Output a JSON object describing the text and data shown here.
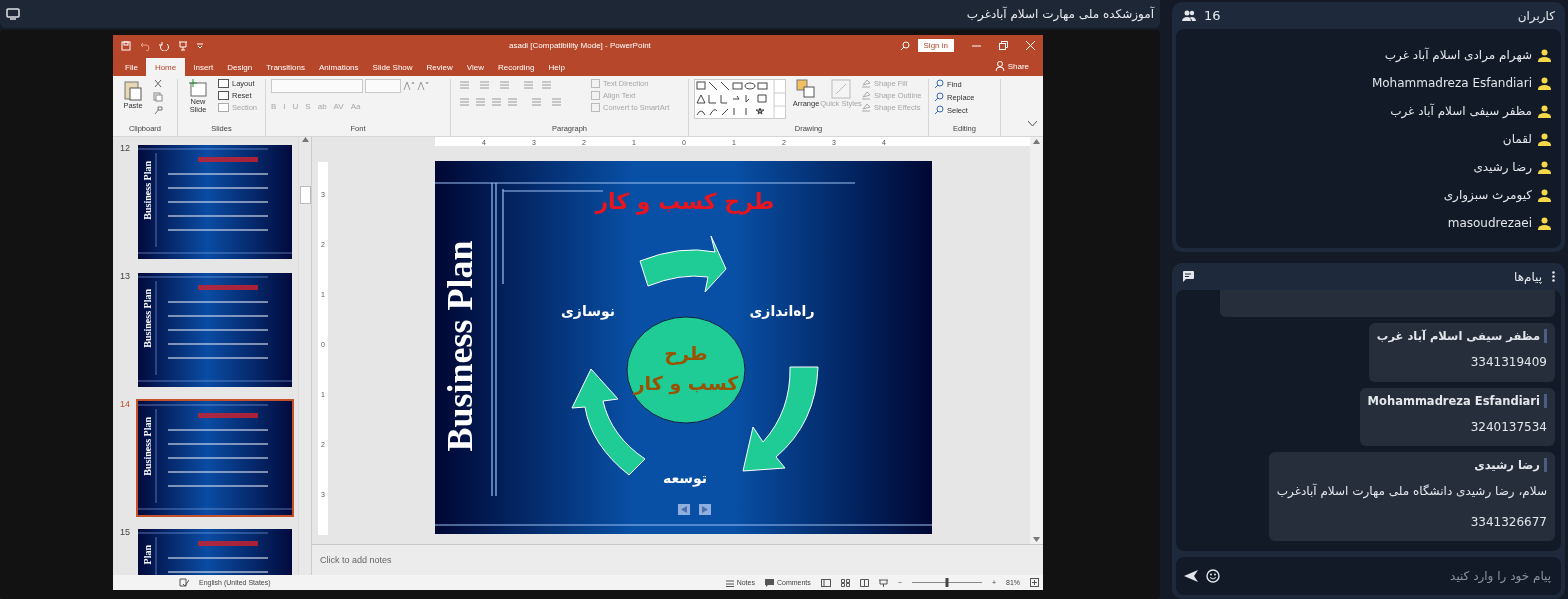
{
  "share_header": {
    "title": "آموزشکده ملی مهارت اسلام آبادغرب"
  },
  "powerpoint": {
    "title": "asadi [Compatibility Mode] - PowerPoint",
    "sign_in": "Sign in",
    "share": "Share",
    "tabs": [
      {
        "label": "File",
        "selected": false
      },
      {
        "label": "Home",
        "selected": true
      },
      {
        "label": "Insert",
        "selected": false
      },
      {
        "label": "Design",
        "selected": false
      },
      {
        "label": "Transitions",
        "selected": false
      },
      {
        "label": "Animations",
        "selected": false
      },
      {
        "label": "Slide Show",
        "selected": false
      },
      {
        "label": "Review",
        "selected": false
      },
      {
        "label": "View",
        "selected": false
      },
      {
        "label": "Recording",
        "selected": false
      },
      {
        "label": "Help",
        "selected": false
      }
    ],
    "ribbon_groups": [
      {
        "kind": "clipboard",
        "label": "Clipboard",
        "big": "Paste"
      },
      {
        "kind": "slides",
        "label": "Slides",
        "big": "New Slide",
        "items": [
          {
            "label": "Layout",
            "disabled": false
          },
          {
            "label": "Reset",
            "disabled": false
          },
          {
            "label": "Section",
            "disabled": true
          }
        ]
      },
      {
        "kind": "font",
        "label": "Font",
        "disabled": true,
        "format_buttons": [
          "B",
          "I",
          "U",
          "S",
          "ab",
          "AV",
          "Aa"
        ]
      },
      {
        "kind": "paragraph",
        "label": "Paragraph",
        "items": [
          {
            "label": "Text Direction",
            "disabled": true
          },
          {
            "label": "Align Text",
            "disabled": true
          },
          {
            "label": "Convert to SmartArt",
            "disabled": true
          }
        ]
      },
      {
        "kind": "drawing",
        "label": "Drawing",
        "big": "Arrange",
        "big2": {
          "label": "Quick Styles",
          "disabled": true
        },
        "items": [
          {
            "label": "Shape Fill",
            "disabled": true
          },
          {
            "label": "Shape Outline",
            "disabled": true
          },
          {
            "label": "Shape Effects",
            "disabled": true
          }
        ]
      },
      {
        "kind": "editing",
        "label": "Editing",
        "items": [
          {
            "label": "Find",
            "disabled": false
          },
          {
            "label": "Replace",
            "disabled": false
          },
          {
            "label": "Select",
            "disabled": false
          }
        ]
      }
    ],
    "thumbnails": [
      {
        "number": "12",
        "selected": false,
        "side_text": "Business Plan"
      },
      {
        "number": "13",
        "selected": false,
        "side_text": "Business Plan"
      },
      {
        "number": "14",
        "selected": true,
        "side_text": "Business Plan"
      },
      {
        "number": "15",
        "selected": false,
        "side_text": "Plan"
      }
    ],
    "ruler_h": [
      "4",
      "3",
      "2",
      "1",
      "0",
      "1",
      "2",
      "3",
      "4"
    ],
    "ruler_v": [
      "3",
      "2",
      "1",
      "0",
      "1",
      "2",
      "3"
    ],
    "slide": {
      "side_title": "Business Plan",
      "title": "طرح کسب و کار",
      "labels": [
        "راه‌اندازی",
        "نوسازی",
        "توسعه"
      ],
      "center_lines": [
        "طرح",
        "کسب و کار"
      ]
    },
    "notes_placeholder": "Click to add notes",
    "status_bar": {
      "language": "English (United States)",
      "notes": "Notes",
      "comments": "Comments",
      "zoom": "81%",
      "zoom_out": "−",
      "zoom_in": "+",
      "zoom_slider": {
        "level": 0.5
      }
    }
  },
  "users_panel": {
    "title": "کاربران",
    "count": "16",
    "users": [
      "شهرام مرادی اسلام آباد غرب",
      "Mohammadreza Esfandiari",
      "مظفر سیفی اسلام آباد غرب",
      "لقمان",
      "رضا رشیدی",
      "کیومرث سبزواری",
      "masoudrezaei"
    ]
  },
  "messages_panel": {
    "title": "پیام‌ها",
    "messages": [
      {
        "sender": "مظفر سیفی اسلام آباد غرب",
        "lines": [
          "3341319409"
        ]
      },
      {
        "sender": "Mohammadreza Esfandiari",
        "lines": [
          "3240137534"
        ]
      },
      {
        "sender": "رضا رشیدی",
        "lines": [
          "سلام، رضا رشیدی دانشگاه ملی مهارت اسلام آبادغرب",
          "3341326677"
        ]
      }
    ],
    "input": {
      "placeholder": "پیام خود را وارد کنید"
    }
  }
}
